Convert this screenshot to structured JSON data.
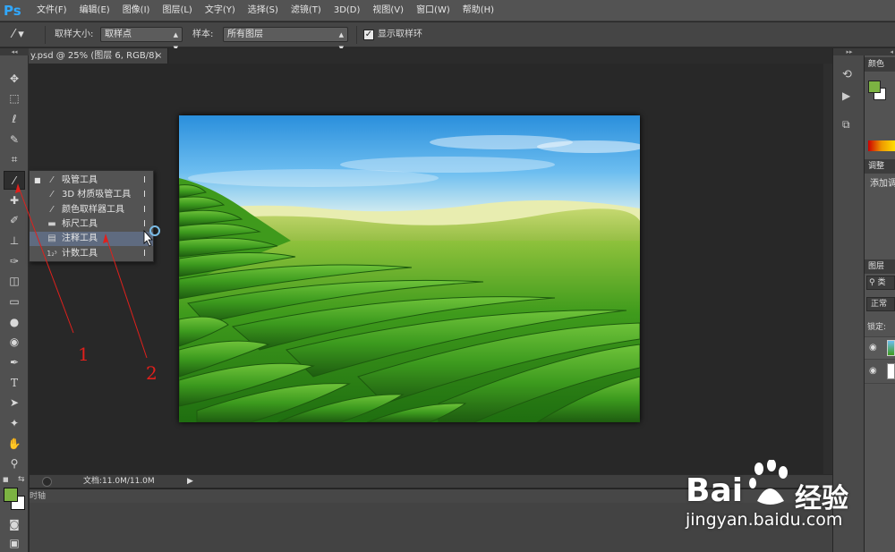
{
  "app": {
    "logo": "Ps"
  },
  "menu": [
    "文件(F)",
    "编辑(E)",
    "图像(I)",
    "图层(L)",
    "文字(Y)",
    "选择(S)",
    "滤镜(T)",
    "3D(D)",
    "视图(V)",
    "窗口(W)",
    "帮助(H)"
  ],
  "options": {
    "sample_size_label": "取样大小:",
    "sample_size_value": "取样点",
    "sample_label": "样本:",
    "sample_value": "所有图层",
    "show_ring_label": "显示取样环",
    "show_ring_checked": true
  },
  "document": {
    "tab_title": "y.psd @ 25% (图层 6, RGB/8)",
    "close": "×",
    "status": "文档:11.0M/11.0M"
  },
  "timeline": {
    "label": "时轴"
  },
  "flyout": {
    "items": [
      {
        "label": "吸管工具",
        "key": "I",
        "icon": "eyedropper-icon",
        "selected": true
      },
      {
        "label": "3D 材质吸管工具",
        "key": "I",
        "icon": "3d-material-eyedropper-icon"
      },
      {
        "label": "颜色取样器工具",
        "key": "I",
        "icon": "color-sampler-icon"
      },
      {
        "label": "标尺工具",
        "key": "I",
        "icon": "ruler-icon"
      },
      {
        "label": "注释工具",
        "key": "I",
        "icon": "note-icon",
        "highlighted": true
      },
      {
        "label": "计数工具",
        "key": "I",
        "icon": "count-icon",
        "icon_text": "1₂³"
      }
    ]
  },
  "annotations": {
    "one": "1",
    "two": "2"
  },
  "panels": {
    "color": "颜色",
    "adjust": "调整",
    "add_adjust": "添加调",
    "layers": "图层",
    "kind": "类",
    "normal": "正常",
    "lock": "锁定:"
  },
  "colors": {
    "foreground": "#7cb342",
    "background": "#ffffff",
    "accent": "#31a8ff",
    "annotation": "#e0201c"
  },
  "watermark": {
    "brand": "Bai",
    "brand2": "经验",
    "url": "jingyan.baidu.com"
  }
}
